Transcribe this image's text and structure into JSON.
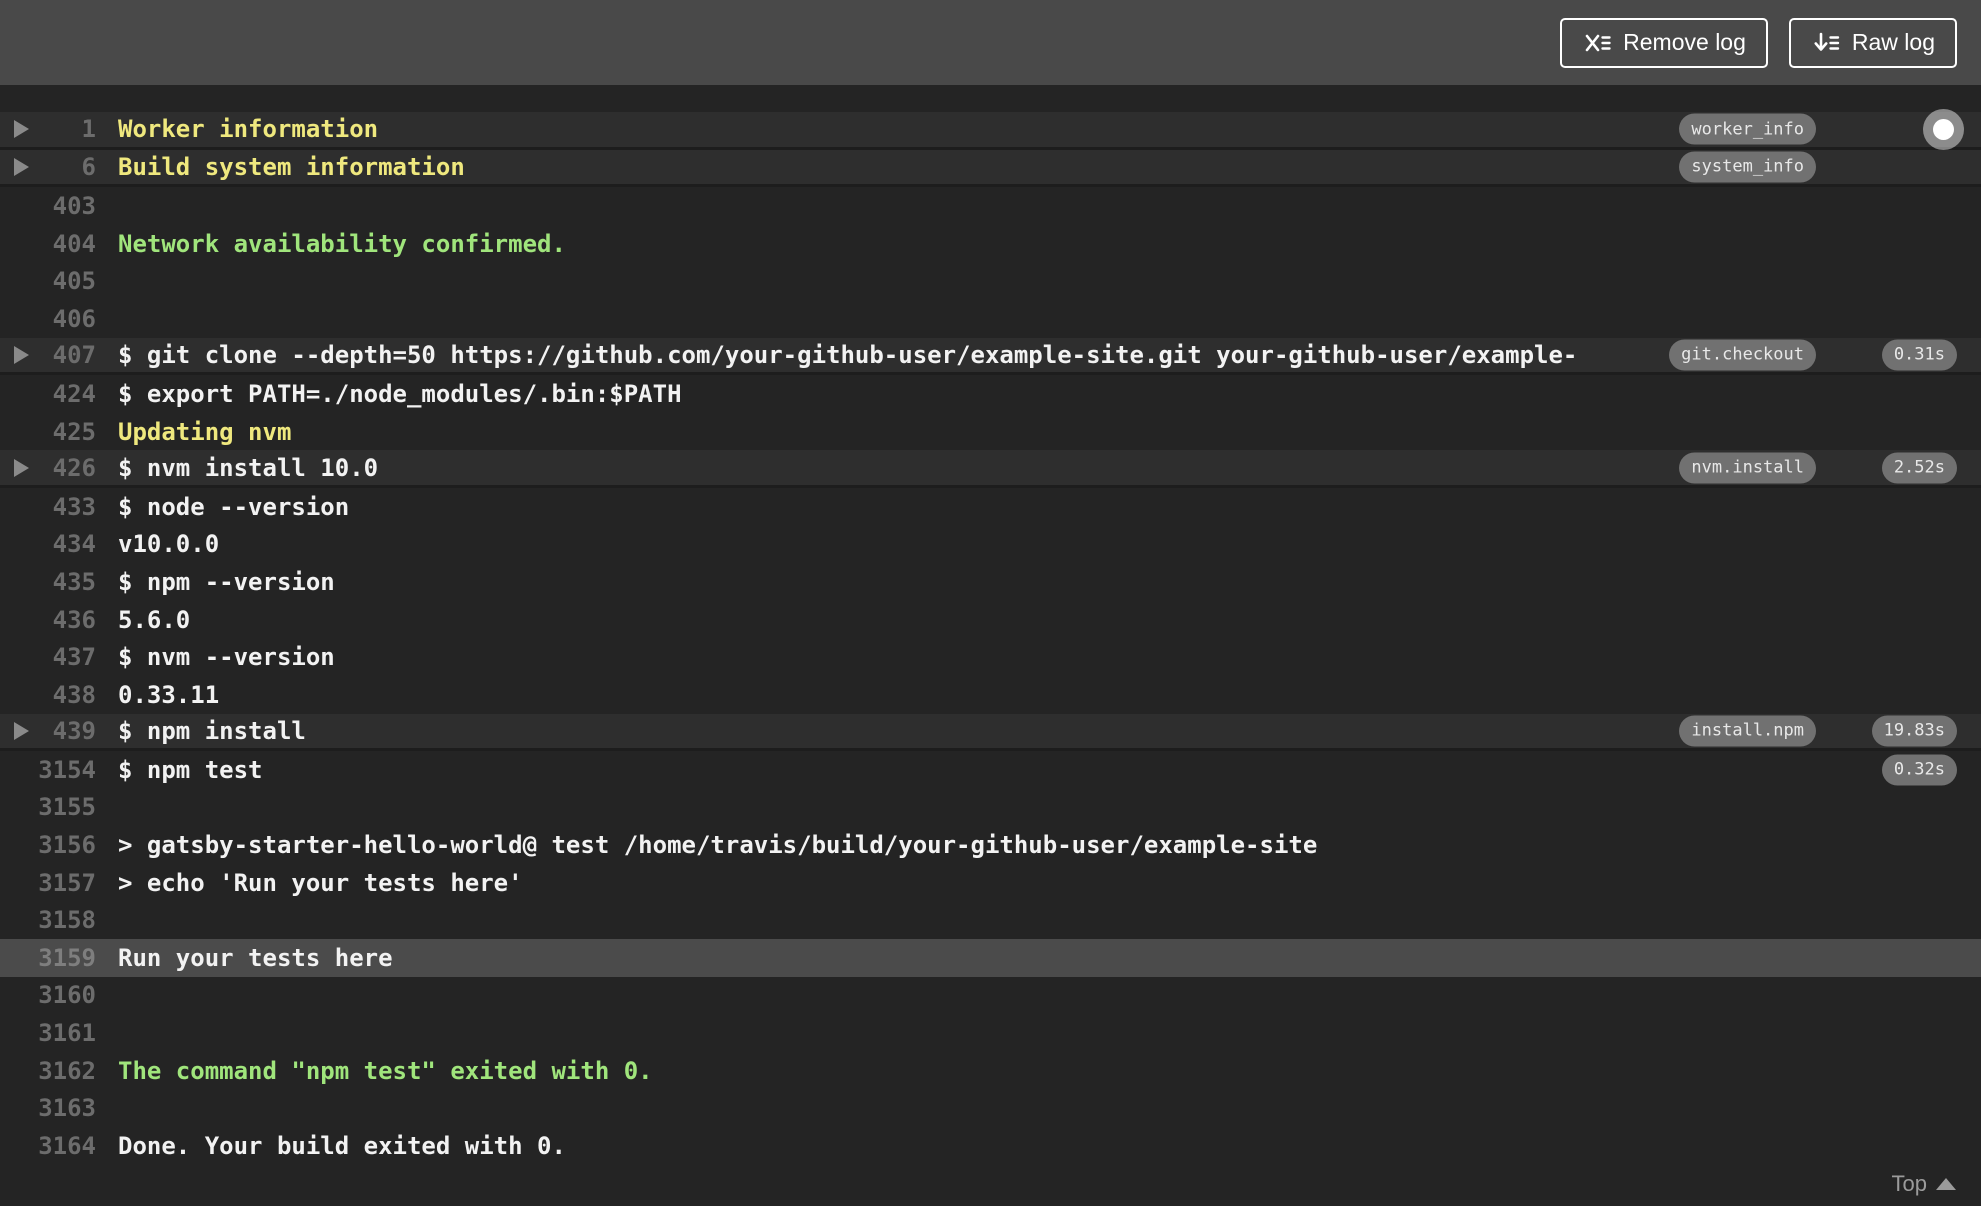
{
  "toolbar": {
    "remove_log_label": "Remove log",
    "raw_log_label": "Raw log",
    "remove_log_icon": "x-with-lines-icon",
    "raw_log_icon": "arrow-down-with-lines-icon"
  },
  "footer": {
    "top_label": "Top",
    "top_icon": "triangle-up-icon"
  },
  "scroll_indicator": "circle-dot",
  "colors": {
    "topbar_bg": "#494949",
    "log_bg": "#242424",
    "fold_row_bg": "#2e2e2e",
    "selected_row_bg": "#4b4b4b",
    "line_number": "#6c6c6c",
    "log_text": "#f2f2f2",
    "fold_title_yellow": "#efe87e",
    "success_green": "#a0e57c",
    "badge_bg": "#717171"
  },
  "log": {
    "rows": [
      {
        "n": "1",
        "text": "Worker information",
        "style": "fold-title",
        "arrow": true,
        "highlight": "fold",
        "badge": "worker_info"
      },
      {
        "n": "6",
        "text": "Build system information",
        "style": "fold-title",
        "arrow": true,
        "highlight": "fold",
        "badge": "system_info"
      },
      {
        "n": "403",
        "text": ""
      },
      {
        "n": "404",
        "text": "Network availability confirmed.",
        "style": "success"
      },
      {
        "n": "405",
        "text": ""
      },
      {
        "n": "406",
        "text": ""
      },
      {
        "n": "407",
        "text": "$ git clone --depth=50 https://github.com/your-github-user/example-site.git your-github-user/example-",
        "arrow": true,
        "highlight": "fold",
        "badge": "git.checkout",
        "duration": "0.31s"
      },
      {
        "n": "424",
        "text": "$ export PATH=./node_modules/.bin:$PATH"
      },
      {
        "n": "425",
        "text": "Updating nvm",
        "style": "fold-title"
      },
      {
        "n": "426",
        "text": "$ nvm install 10.0",
        "arrow": true,
        "highlight": "fold",
        "badge": "nvm.install",
        "duration": "2.52s"
      },
      {
        "n": "433",
        "text": "$ node --version"
      },
      {
        "n": "434",
        "text": "v10.0.0"
      },
      {
        "n": "435",
        "text": "$ npm --version"
      },
      {
        "n": "436",
        "text": "5.6.0"
      },
      {
        "n": "437",
        "text": "$ nvm --version"
      },
      {
        "n": "438",
        "text": "0.33.11"
      },
      {
        "n": "439",
        "text": "$ npm install",
        "arrow": true,
        "highlight": "fold",
        "badge": "install.npm",
        "duration": "19.83s"
      },
      {
        "n": "3154",
        "text": "$ npm test",
        "duration": "0.32s"
      },
      {
        "n": "3155",
        "text": ""
      },
      {
        "n": "3156",
        "text": "> gatsby-starter-hello-world@ test /home/travis/build/your-github-user/example-site"
      },
      {
        "n": "3157",
        "text": "> echo 'Run your tests here'"
      },
      {
        "n": "3158",
        "text": ""
      },
      {
        "n": "3159",
        "text": "Run your tests here",
        "highlight": "selected"
      },
      {
        "n": "3160",
        "text": ""
      },
      {
        "n": "3161",
        "text": ""
      },
      {
        "n": "3162",
        "text": "The command \"npm test\" exited with 0.",
        "style": "success"
      },
      {
        "n": "3163",
        "text": ""
      },
      {
        "n": "3164",
        "text": "Done. Your build exited with 0."
      }
    ]
  }
}
